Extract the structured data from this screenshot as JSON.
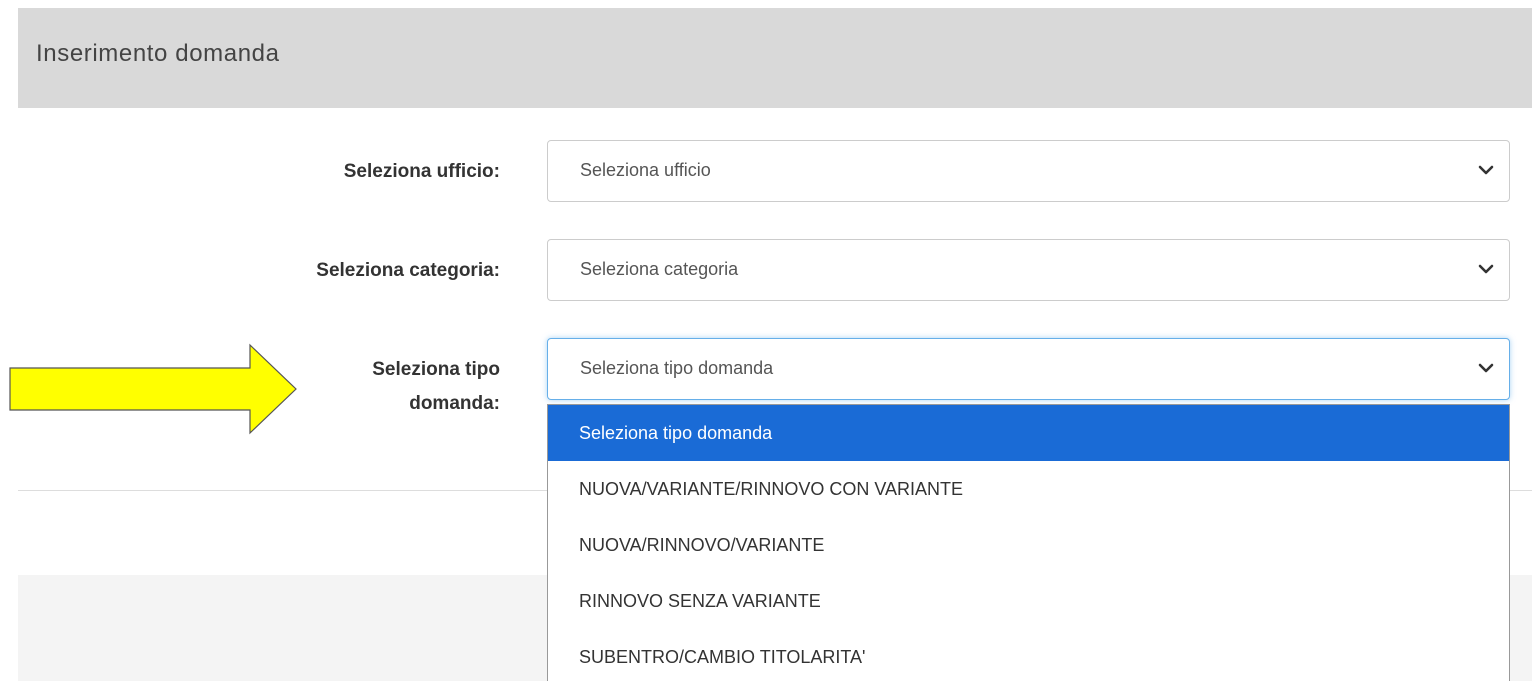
{
  "header": {
    "title": "Inserimento domanda"
  },
  "form": {
    "ufficio": {
      "label": "Seleziona ufficio:",
      "value": "Seleziona ufficio"
    },
    "categoria": {
      "label": "Seleziona categoria:",
      "value": "Seleziona categoria"
    },
    "tipo": {
      "label_line1": "Seleziona tipo",
      "label_line2": "domanda:",
      "value": "Seleziona tipo domanda",
      "options": [
        "Seleziona tipo domanda",
        "NUOVA/VARIANTE/RINNOVO CON VARIANTE",
        "NUOVA/RINNOVO/VARIANTE",
        "RINNOVO SENZA VARIANTE",
        "SUBENTRO/CAMBIO TITOLARITA'"
      ],
      "selected_option": "Seleziona tipo domanda"
    }
  },
  "icons": {
    "chevron": "chevron-down-icon",
    "annotation": "yellow-arrow"
  },
  "colors": {
    "header_bg": "#d9d9d9",
    "selected_option_bg": "#1a6bd6",
    "focus_border": "#66afe9",
    "arrow_fill": "#ffff00"
  }
}
